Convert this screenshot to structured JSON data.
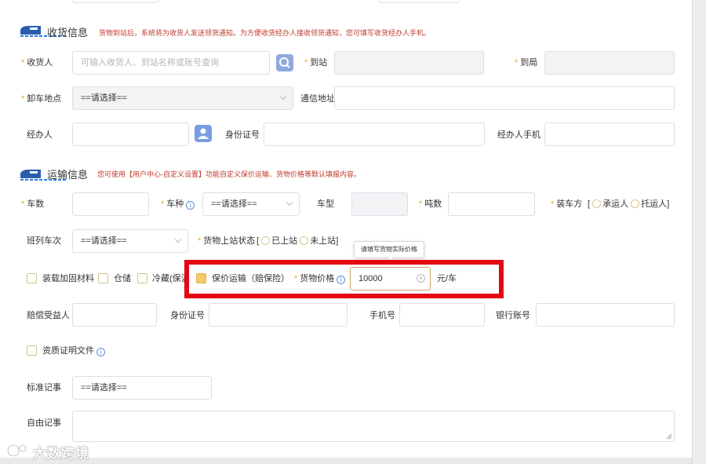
{
  "receiver_section": {
    "title": "收货信息",
    "note": "货物到站后，系统将为收货人发送领货通知。为方便收货经办人接收领货通知，您可填写收货经办人手机。",
    "receiver_label": "收货人",
    "receiver_placeholder": "可输入收货人、到站名称或账号查询",
    "station_label": "到站",
    "bureau_label": "到局",
    "unload_label": "卸车地点",
    "unload_value": "==请选择==",
    "address_label": "通信地址",
    "agent_label": "经办人",
    "id_label": "身份证号",
    "agent_phone_label": "经办人手机"
  },
  "transport_section": {
    "title": "运输信息",
    "note": "您可使用【用户中心-自定义设置】功能自定义保价运输、货物价格等默认填报内容。",
    "car_count_label": "车数",
    "car_type_label": "车种",
    "car_type_value": "==请选择==",
    "car_model_label": "车型",
    "tonnage_label": "吨数",
    "loader_label": "装车方",
    "loader_bracket_open": "[",
    "loader_opt1": "承运人",
    "loader_opt2": "托运人",
    "loader_bracket_close": "]",
    "train_label": "班列车次",
    "train_value": "==请选择==",
    "goods_status_label": "货物上站状态",
    "status_bracket_open": "[",
    "status_opt1": "已上站",
    "status_opt2": "未上站",
    "status_bracket_close": "]",
    "check_reinforce": "装载加固材料",
    "check_storage": "仓储",
    "check_cold": "冷藏(保温",
    "check_insured": "保价运输（赔保险）",
    "goods_price_label": "货物价格",
    "goods_price_value": "10000",
    "price_unit": "元/车",
    "tooltip": "请填写货物实际价格",
    "beneficiary_label": "赔偿受益人",
    "id_label": "身份证号",
    "phone_label": "手机号",
    "bank_label": "银行账号",
    "cert_label": "资质证明文件",
    "std_record_label": "标准记事",
    "std_record_value": "==请选择==",
    "free_record_label": "自由记事"
  },
  "watermark": "大数跨境",
  "colors": {
    "required_star": "#e6a23c",
    "note_red": "#c0392b",
    "highlight_red": "#e30613",
    "checkbox_checked": "#f4c96a",
    "info_blue": "#5b8fd6"
  }
}
